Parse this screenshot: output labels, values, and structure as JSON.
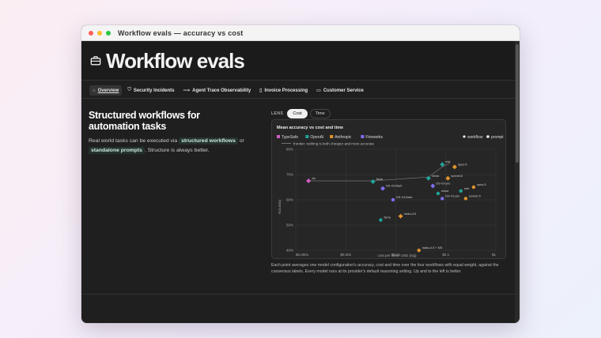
{
  "window": {
    "title": "Workflow evals — accuracy vs cost"
  },
  "header": {
    "title": "Workflow evals"
  },
  "tabs": [
    {
      "label": "Overview",
      "icon": "home-icon",
      "active": true
    },
    {
      "label": "Security Incidents",
      "icon": "shield-icon",
      "active": false
    },
    {
      "label": "Agent Trace Observability",
      "icon": "trace-icon",
      "active": false
    },
    {
      "label": "Invoice Processing",
      "icon": "document-icon",
      "active": false
    },
    {
      "label": "Customer Service",
      "icon": "chat-icon",
      "active": false
    }
  ],
  "intro": {
    "heading": "Structured workflows for automation tasks",
    "text_1": "Real world tasks can be executed via",
    "highlight_1": "structured workflows",
    "text_2": "or",
    "highlight_2": "standalone prompts",
    "text_3": ". Structure is always better."
  },
  "lens": {
    "label": "LENS",
    "options": [
      "Cost",
      "Time"
    ],
    "selected": "Cost"
  },
  "legend": {
    "providers": [
      {
        "name": "TypeSafe",
        "color": "#d05fc8"
      },
      {
        "name": "OpenAI",
        "color": "#1fa59a"
      },
      {
        "name": "Anthropic",
        "color": "#e0942e"
      },
      {
        "name": "Fireworks",
        "color": "#7d6ff0"
      }
    ],
    "modes": [
      {
        "name": "workflow",
        "shape": "diamond"
      },
      {
        "name": "prompt",
        "shape": "circle"
      }
    ]
  },
  "caption": "Each point averages one model configuration's accuracy, cost and time over the four workflows with equal weight, against the consensus labels. Every model runs at its provider's default reasoning setting. Up and to the left is better.",
  "chart_data": {
    "type": "scatter",
    "title": "Mean accuracy vs cost and time",
    "frontier_label": "frontier: nothing is both cheaper and more accurate",
    "xlabel": "cost per case, USD (log)",
    "ylabel": "Accuracy",
    "x_scale": "log",
    "xlim": [
      0.0001,
      1
    ],
    "x_ticks": [
      "$0.0001",
      "$0.001",
      "$0.01",
      "$0.1",
      "$1"
    ],
    "ylim": [
      40,
      80
    ],
    "y_ticks": [
      "40%",
      "50%",
      "60%",
      "70%",
      "80%"
    ],
    "grid": true,
    "legend_position": "top",
    "frontier": [
      [
        0.00018,
        67.5
      ],
      [
        0.0035,
        67.5
      ],
      [
        0.045,
        69
      ],
      [
        0.085,
        73
      ],
      [
        0.12,
        74.5
      ]
    ],
    "points": [
      {
        "label": "cfo",
        "provider": "TypeSafe",
        "mode": "workflow",
        "x": 0.00018,
        "y": 67.5
      },
      {
        "label": "fsma",
        "provider": "OpenAI",
        "mode": "workflow",
        "x": 0.0035,
        "y": 67.2
      },
      {
        "label": "DS-V3-flash",
        "provider": "Fireworks",
        "mode": "workflow",
        "x": 0.0055,
        "y": 64.5
      },
      {
        "label": "mima",
        "provider": "OpenAI",
        "mode": "workflow",
        "x": 0.045,
        "y": 68.5
      },
      {
        "label": "DS-V3-pro",
        "provider": "Fireworks",
        "mode": "workflow",
        "x": 0.055,
        "y": 65.5
      },
      {
        "label": "mid",
        "provider": "OpenAI",
        "mode": "workflow",
        "x": 0.085,
        "y": 74
      },
      {
        "label": "opus-5",
        "provider": "Anthropic",
        "mode": "workflow",
        "x": 0.15,
        "y": 73
      },
      {
        "label": "sonnet-5",
        "provider": "Anthropic",
        "mode": "workflow",
        "x": 0.11,
        "y": 68.5
      },
      {
        "label": "opus-5",
        "provider": "Anthropic",
        "mode": "prompt",
        "x": 0.36,
        "y": 65
      },
      {
        "label": "mid",
        "provider": "OpenAI",
        "mode": "prompt",
        "x": 0.2,
        "y": 63.5
      },
      {
        "label": "mima",
        "provider": "OpenAI",
        "mode": "prompt",
        "x": 0.07,
        "y": 62.5
      },
      {
        "label": "DS-V3-pro",
        "provider": "Fireworks",
        "mode": "prompt",
        "x": 0.085,
        "y": 60.5
      },
      {
        "label": "sonnet-5",
        "provider": "Anthropic",
        "mode": "prompt",
        "x": 0.25,
        "y": 60.5
      },
      {
        "label": "DS-V3-flash",
        "provider": "Fireworks",
        "mode": "prompt",
        "x": 0.0088,
        "y": 60
      },
      {
        "label": "haiku-4.5",
        "provider": "Anthropic",
        "mode": "workflow",
        "x": 0.0125,
        "y": 53.5
      },
      {
        "label": "fsma",
        "provider": "OpenAI",
        "mode": "prompt",
        "x": 0.005,
        "y": 52
      },
      {
        "label": "haiku-4.5 + MS",
        "provider": "Anthropic",
        "mode": "prompt",
        "x": 0.029,
        "y": 40
      }
    ]
  }
}
